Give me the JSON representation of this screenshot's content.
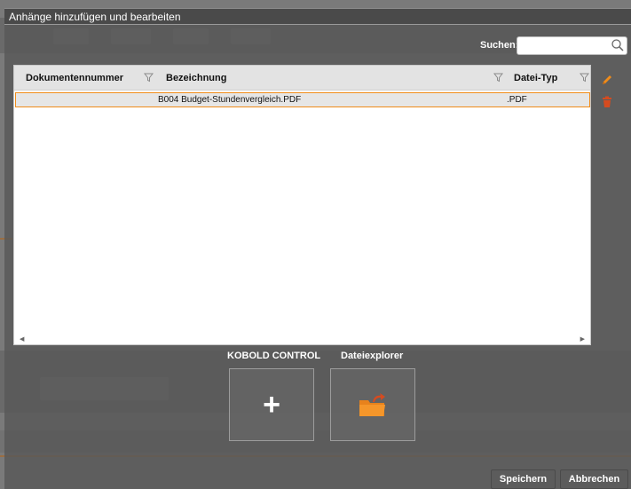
{
  "dialog": {
    "title": "Anhänge hinzufügen und bearbeiten"
  },
  "search": {
    "label": "Suchen:",
    "value": "",
    "placeholder": ""
  },
  "grid": {
    "columns": [
      "Dokumentennummer",
      "Bezeichnung",
      "Datei-Typ"
    ],
    "rows": [
      {
        "dokumentennummer": "",
        "bezeichnung": "B004 Budget-Stundenvergleich.PDF",
        "datei_typ": ".PDF",
        "selected": true
      }
    ]
  },
  "sources": [
    {
      "label": "KOBOLD CONTROL",
      "icon": "plus-icon"
    },
    {
      "label": "Dateiexplorer",
      "icon": "folder-open-icon"
    }
  ],
  "buttons": {
    "save": "Speichern",
    "cancel": "Abbrechen"
  },
  "colors": {
    "accent": "#f08c1a",
    "delete": "#d64b1f",
    "dialog_bg": "#585858"
  }
}
